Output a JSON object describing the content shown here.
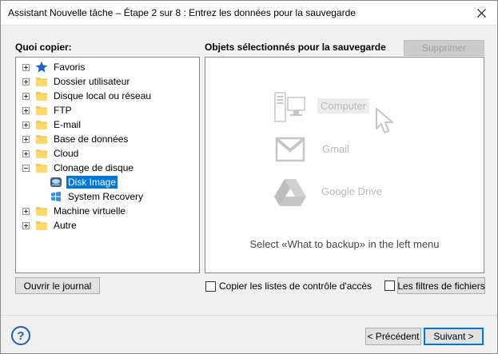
{
  "window": {
    "title": "Assistant Nouvelle tâche – Étape 2 sur 8 : Entrez les données pour la sauvegarde"
  },
  "left": {
    "heading": "Quoi copier:",
    "tree": [
      {
        "label": "Favoris",
        "icon": "star-icon",
        "expander": "plus"
      },
      {
        "label": "Dossier utilisateur",
        "icon": "folder-icon",
        "expander": "plus"
      },
      {
        "label": "Disque local ou réseau",
        "icon": "folder-icon",
        "expander": "plus"
      },
      {
        "label": "FTP",
        "icon": "folder-icon",
        "expander": "plus"
      },
      {
        "label": "E-mail",
        "icon": "folder-icon",
        "expander": "plus"
      },
      {
        "label": "Base de données",
        "icon": "folder-icon",
        "expander": "plus"
      },
      {
        "label": "Cloud",
        "icon": "folder-icon",
        "expander": "plus"
      },
      {
        "label": "Clonage de disque",
        "icon": "folder-icon",
        "expander": "minus",
        "children": [
          {
            "label": "Disk Image",
            "icon": "disk-image-icon",
            "selected": true
          },
          {
            "label": "System Recovery",
            "icon": "windows-icon",
            "selected": false
          }
        ]
      },
      {
        "label": "Machine virtuelle",
        "icon": "folder-icon",
        "expander": "plus"
      },
      {
        "label": "Autre",
        "icon": "folder-icon",
        "expander": "plus"
      }
    ],
    "open_log_button": "Ouvrir le journal"
  },
  "right": {
    "heading": "Objets sélectionnés pour la sauvegarde",
    "delete_button": "Supprimer",
    "services": [
      {
        "label": "Computer",
        "icon": "computer-icon"
      },
      {
        "label": "Gmail",
        "icon": "gmail-icon"
      },
      {
        "label": "Google Drive",
        "icon": "google-drive-icon"
      }
    ],
    "hint": "Select «What to backup» in the left menu",
    "copy_acl_label": "Copier les listes de contrôle d'accès",
    "file_filters_label": "Les filtres de fichiers"
  },
  "footer": {
    "help_label": "?",
    "prev_button": "< Précédent",
    "next_button": "Suivant >"
  },
  "colors": {
    "selection": "#0078d7",
    "folder": "#ffc83d",
    "star": "#1e64c8",
    "help": "#1c5fb0"
  }
}
